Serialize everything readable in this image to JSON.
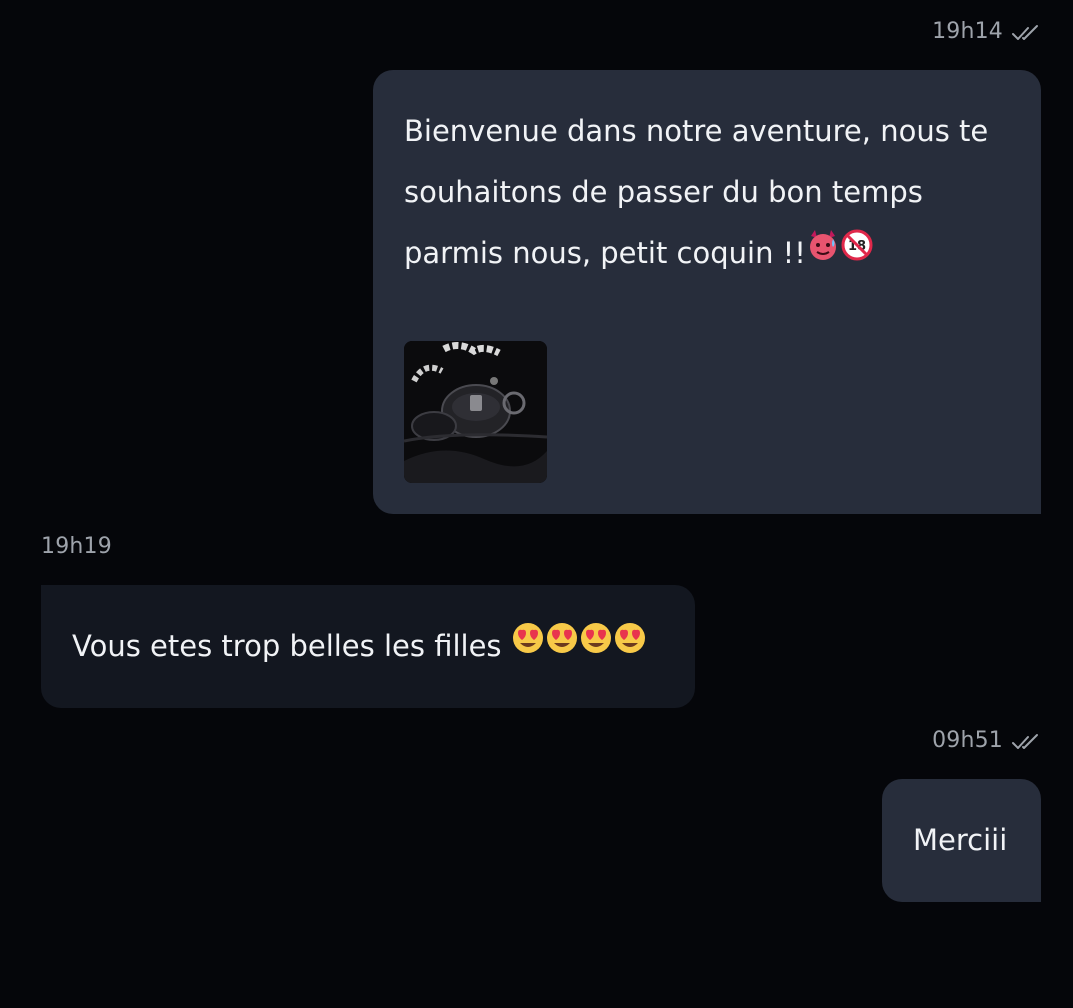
{
  "messages": [
    {
      "direction": "outgoing",
      "time": "19h14",
      "read_icon": "double-check-icon",
      "text": "Bienvenue dans notre aventure, nous te souhaitons de passer du bon temps parmis nous, petit coquin !!",
      "emojis": [
        "hot-face-devil-emoji",
        "no-under-18-emoji"
      ],
      "attachment": {
        "kind": "image",
        "icon": "photo-thumbnail"
      }
    },
    {
      "direction": "incoming",
      "time": "19h19",
      "text": "Vous etes trop belles les filles",
      "emojis": [
        "heart-eyes-emoji",
        "heart-eyes-emoji",
        "heart-eyes-emoji",
        "heart-eyes-emoji"
      ]
    },
    {
      "direction": "outgoing",
      "time": "09h51",
      "read_icon": "double-check-icon",
      "text": "Merciii"
    }
  ],
  "colors": {
    "background": "#05060a",
    "outgoing_bubble": "#272d3b",
    "incoming_bubble": "#131720",
    "timestamp": "#9ea3ab",
    "text": "#f1f3f6"
  }
}
